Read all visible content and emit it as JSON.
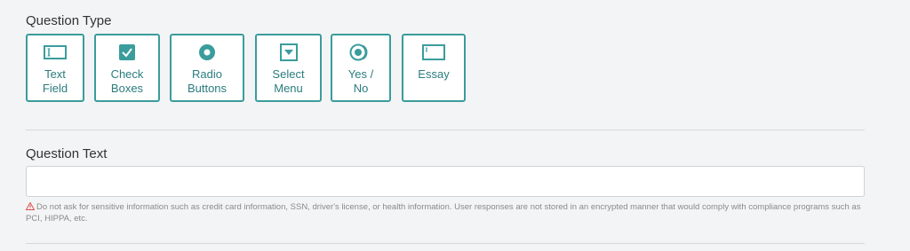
{
  "question_type": {
    "label": "Question Type",
    "options": [
      {
        "label": "Text\nField",
        "icon": "text-field-icon"
      },
      {
        "label": "Check\nBoxes",
        "icon": "checkbox-icon"
      },
      {
        "label": "Radio\nButtons",
        "icon": "radio-button-icon"
      },
      {
        "label": "Select\nMenu",
        "icon": "select-menu-icon"
      },
      {
        "label": "Yes /\nNo",
        "icon": "yes-no-toggle-icon"
      },
      {
        "label": "Essay",
        "icon": "essay-icon"
      }
    ]
  },
  "question_text": {
    "label": "Question Text",
    "value": "",
    "placeholder": "",
    "warning": "Do not ask for sensitive information such as credit card information, SSN, driver's license, or health information. User responses are not stored in an encrypted manner that would comply with compliance programs such as PCI, HIPPA, etc."
  },
  "colors": {
    "accent": "#3b9c9c",
    "accent_text": "#2a7c7e",
    "background": "#f3f4f5",
    "warning_icon": "#d9534f"
  }
}
